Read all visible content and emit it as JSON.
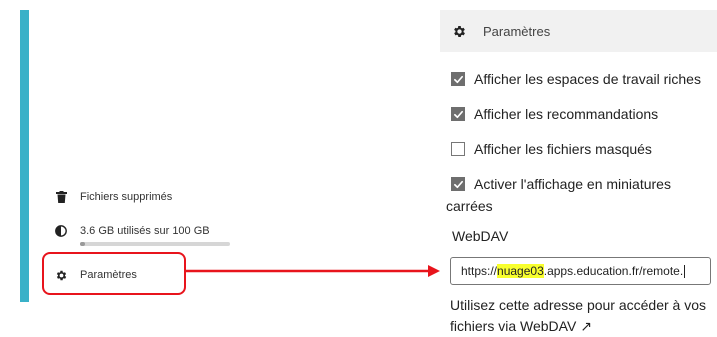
{
  "left_nav": {
    "deleted_files": {
      "label": "Fichiers supprimés",
      "icon": "trash-icon"
    },
    "quota": {
      "label": "3.6 GB utilisés sur 100 GB",
      "icon": "pie-chart-icon",
      "used_fraction": 0.036
    },
    "settings": {
      "label": "Paramètres",
      "icon": "gear-icon"
    }
  },
  "settings_panel": {
    "title": "Paramètres",
    "options": [
      {
        "label": "Afficher les espaces de travail riches",
        "checked": true
      },
      {
        "label": "Afficher les recommandations",
        "checked": true
      },
      {
        "label": "Afficher les fichiers masqués",
        "checked": false
      },
      {
        "label": "Activer l'affichage en miniatures",
        "label_cont": "carrées",
        "checked": true
      }
    ],
    "webdav": {
      "label": "WebDAV",
      "url_prefix": "https://",
      "url_highlight": "nuage03",
      "url_rest": ".apps.education.fr/remote.",
      "help_text": "Utilisez cette adresse pour accéder à vos fichiers via WebDAV ↗"
    }
  },
  "colors": {
    "accent": "#3ab1c8",
    "annotation_red": "#e8141c",
    "url_highlight": "#f8ff2e",
    "checkbox_checked": "#6e6e6e"
  }
}
